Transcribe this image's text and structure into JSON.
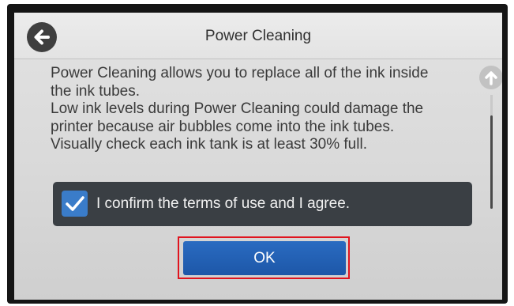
{
  "header": {
    "title": "Power Cleaning",
    "back_icon": "arrow-left-icon"
  },
  "message": {
    "lines": [
      "Power Cleaning allows you to replace all of the ink inside",
      "the ink tubes.",
      "Low ink levels during Power Cleaning could damage the",
      "printer because air bubbles come into the ink tubes.",
      "Visually check each ink tank is at least 30% full."
    ]
  },
  "scrollbar": {
    "up_icon": "arrow-up-icon"
  },
  "agreement": {
    "label": "I confirm the terms of use and I agree.",
    "checked": true,
    "check_icon": "checkmark-icon"
  },
  "actions": {
    "ok_label": "OK"
  },
  "colors": {
    "primary_button": "#1d57a8",
    "checkbox": "#3a7cc9",
    "agree_row_bg": "#3a3f44",
    "highlight_border": "#e0141e"
  }
}
